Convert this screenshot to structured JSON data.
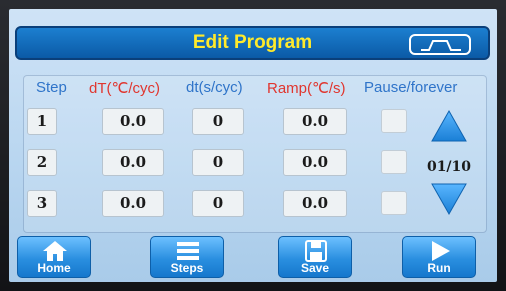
{
  "header": {
    "title": "Edit Program",
    "wave_icon": "waveform-icon"
  },
  "columns": {
    "step": "Step",
    "dT": "dT(℃/cyc)",
    "dt": "dt(s/cyc)",
    "ramp": "Ramp(℃/s)",
    "pause": "Pause/forever"
  },
  "colors": {
    "step_header": "#2f74c9",
    "dT_header": "#e0362f",
    "dt_header": "#2f74c9",
    "ramp_header": "#e0362f",
    "pause_header": "#2f74c9",
    "title_text": "#ffea2b"
  },
  "rows": [
    {
      "step": "1",
      "dT": "0.0",
      "dt": "0",
      "ramp": "0.0",
      "pause": false
    },
    {
      "step": "2",
      "dT": "0.0",
      "dt": "0",
      "ramp": "0.0",
      "pause": false
    },
    {
      "step": "3",
      "dT": "0.0",
      "dt": "0",
      "ramp": "0.0",
      "pause": false
    }
  ],
  "pager": {
    "text": "01/10",
    "up_icon": "arrow-up-icon",
    "down_icon": "arrow-down-icon"
  },
  "nav": {
    "home": "Home",
    "steps": "Steps",
    "save": "Save",
    "run": "Run"
  }
}
